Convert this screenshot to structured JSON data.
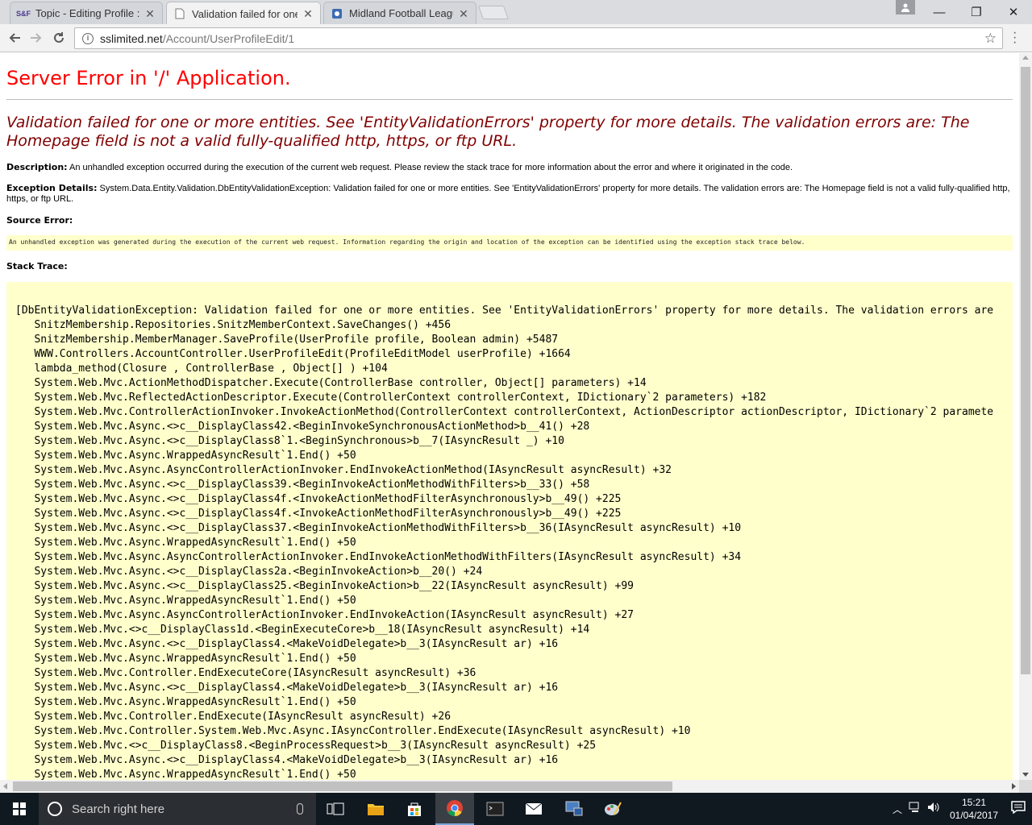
{
  "browser": {
    "tabs": [
      {
        "title": "Topic - Editing Profile : S",
        "favicon_text": "S&F",
        "active": false
      },
      {
        "title": "Validation failed for one",
        "favicon_text": "",
        "active": true
      },
      {
        "title": "Midland Football League",
        "favicon_text": "",
        "active": false
      }
    ],
    "url_host": "sslimited.net",
    "url_path": "/Account/UserProfileEdit/1",
    "window": {
      "minimize": "—",
      "maximize": "❐",
      "close": "✕"
    }
  },
  "error_page": {
    "title": "Server Error in '/' Application.",
    "message": "Validation failed for one or more entities. See 'EntityValidationErrors' property for more details. The validation errors are: The Homepage field is not a valid fully-qualified http, https, or ftp URL.",
    "description_label": "Description:",
    "description_text": " An unhandled exception occurred during the execution of the current web request. Please review the stack trace for more information about the error and where it originated in the code.",
    "exception_label": "Exception Details:",
    "exception_text": " System.Data.Entity.Validation.DbEntityValidationException: Validation failed for one or more entities. See 'EntityValidationErrors' property for more details. The validation errors are: The Homepage field is not a valid fully-qualified http, https, or ftp URL.",
    "source_error_label": "Source Error:",
    "source_error_text": "An unhandled exception was generated during the execution of the current web request. Information regarding the origin and location of the exception can be identified using the exception stack trace below.",
    "stack_trace_label": "Stack Trace:",
    "stack_trace": [
      "[DbEntityValidationException: Validation failed for one or more entities. See 'EntityValidationErrors' property for more details. The validation errors are",
      "   SnitzMembership.Repositories.SnitzMemberContext.SaveChanges() +456",
      "   SnitzMembership.MemberManager.SaveProfile(UserProfile profile, Boolean admin) +5487",
      "   WWW.Controllers.AccountController.UserProfileEdit(ProfileEditModel userProfile) +1664",
      "   lambda_method(Closure , ControllerBase , Object[] ) +104",
      "   System.Web.Mvc.ActionMethodDispatcher.Execute(ControllerBase controller, Object[] parameters) +14",
      "   System.Web.Mvc.ReflectedActionDescriptor.Execute(ControllerContext controllerContext, IDictionary`2 parameters) +182",
      "   System.Web.Mvc.ControllerActionInvoker.InvokeActionMethod(ControllerContext controllerContext, ActionDescriptor actionDescriptor, IDictionary`2 paramete",
      "   System.Web.Mvc.Async.<>c__DisplayClass42.<BeginInvokeSynchronousActionMethod>b__41() +28",
      "   System.Web.Mvc.Async.<>c__DisplayClass8`1.<BeginSynchronous>b__7(IAsyncResult _) +10",
      "   System.Web.Mvc.Async.WrappedAsyncResult`1.End() +50",
      "   System.Web.Mvc.Async.AsyncControllerActionInvoker.EndInvokeActionMethod(IAsyncResult asyncResult) +32",
      "   System.Web.Mvc.Async.<>c__DisplayClass39.<BeginInvokeActionMethodWithFilters>b__33() +58",
      "   System.Web.Mvc.Async.<>c__DisplayClass4f.<InvokeActionMethodFilterAsynchronously>b__49() +225",
      "   System.Web.Mvc.Async.<>c__DisplayClass4f.<InvokeActionMethodFilterAsynchronously>b__49() +225",
      "   System.Web.Mvc.Async.<>c__DisplayClass37.<BeginInvokeActionMethodWithFilters>b__36(IAsyncResult asyncResult) +10",
      "   System.Web.Mvc.Async.WrappedAsyncResult`1.End() +50",
      "   System.Web.Mvc.Async.AsyncControllerActionInvoker.EndInvokeActionMethodWithFilters(IAsyncResult asyncResult) +34",
      "   System.Web.Mvc.Async.<>c__DisplayClass2a.<BeginInvokeAction>b__20() +24",
      "   System.Web.Mvc.Async.<>c__DisplayClass25.<BeginInvokeAction>b__22(IAsyncResult asyncResult) +99",
      "   System.Web.Mvc.Async.WrappedAsyncResult`1.End() +50",
      "   System.Web.Mvc.Async.AsyncControllerActionInvoker.EndInvokeAction(IAsyncResult asyncResult) +27",
      "   System.Web.Mvc.<>c__DisplayClass1d.<BeginExecuteCore>b__18(IAsyncResult asyncResult) +14",
      "   System.Web.Mvc.Async.<>c__DisplayClass4.<MakeVoidDelegate>b__3(IAsyncResult ar) +16",
      "   System.Web.Mvc.Async.WrappedAsyncResult`1.End() +50",
      "   System.Web.Mvc.Controller.EndExecuteCore(IAsyncResult asyncResult) +36",
      "   System.Web.Mvc.Async.<>c__DisplayClass4.<MakeVoidDelegate>b__3(IAsyncResult ar) +16",
      "   System.Web.Mvc.Async.WrappedAsyncResult`1.End() +50",
      "   System.Web.Mvc.Controller.EndExecute(IAsyncResult asyncResult) +26",
      "   System.Web.Mvc.Controller.System.Web.Mvc.Async.IAsyncController.EndExecute(IAsyncResult asyncResult) +10",
      "   System.Web.Mvc.<>c__DisplayClass8.<BeginProcessRequest>b__3(IAsyncResult asyncResult) +25",
      "   System.Web.Mvc.Async.<>c__DisplayClass4.<MakeVoidDelegate>b__3(IAsyncResult ar) +16",
      "   System.Web.Mvc.Async.WrappedAsyncResult`1.End() +50"
    ]
  },
  "taskbar": {
    "search_placeholder": "Search right here",
    "time": "15:21",
    "date": "01/04/2017",
    "apps": [
      "task-view-icon",
      "file-explorer-icon",
      "store-icon",
      "chrome-icon",
      "terminal-icon",
      "mail-icon",
      "network-app-icon",
      "paint-app-icon"
    ]
  },
  "colors": {
    "error_title": "#ff0000",
    "error_message": "#800000",
    "code_background": "#ffffcc"
  }
}
